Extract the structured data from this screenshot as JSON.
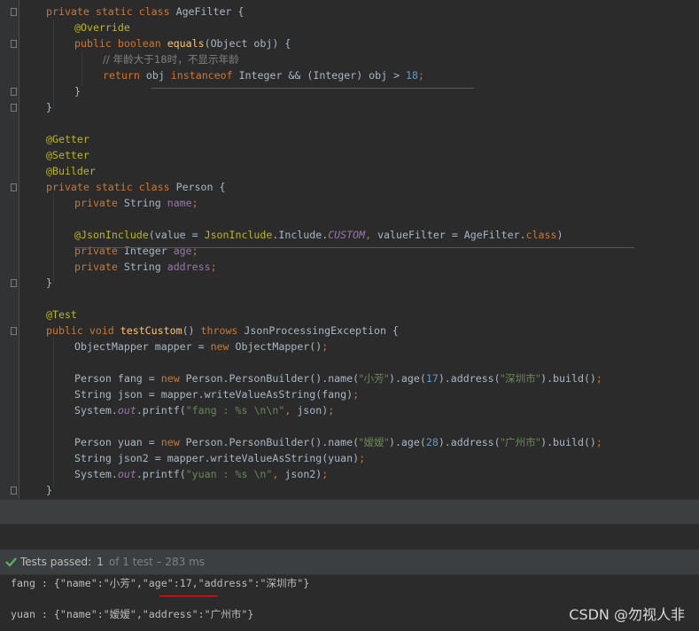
{
  "code": {
    "lines": [
      [
        [
          "kw",
          "private static class "
        ],
        [
          "p",
          "AgeFilter {"
        ]
      ],
      [
        [
          "ann",
          "@Override"
        ]
      ],
      [
        [
          "kw",
          "public boolean "
        ],
        [
          "fn",
          "equals"
        ],
        [
          "p",
          "(Object obj) {"
        ]
      ],
      [
        [
          "cmt",
          "// 年龄大于18时，不显示年龄"
        ]
      ],
      [
        [
          "kw",
          "return "
        ],
        [
          "p",
          "obj "
        ],
        [
          "kw",
          "instanceof "
        ],
        [
          "p",
          "Integer && (Integer) obj > "
        ],
        [
          "num",
          "18"
        ],
        [
          "kw",
          ";"
        ]
      ],
      [
        [
          "p",
          "}"
        ]
      ],
      [
        [
          "p",
          "}"
        ]
      ],
      [],
      [
        [
          "ann",
          "@Getter"
        ]
      ],
      [
        [
          "ann",
          "@Setter"
        ]
      ],
      [
        [
          "ann",
          "@Builder"
        ]
      ],
      [
        [
          "kw",
          "private static class "
        ],
        [
          "p",
          "Person {"
        ]
      ],
      [
        [
          "kw",
          "private "
        ],
        [
          "p",
          "String "
        ],
        [
          "fld",
          "name"
        ],
        [
          "kw",
          ";"
        ]
      ],
      [],
      [
        [
          "ann",
          "@JsonInclude"
        ],
        [
          "p",
          "(value = "
        ],
        [
          "ann",
          "JsonInclude"
        ],
        [
          "p",
          "."
        ],
        [
          "p",
          "Include."
        ],
        [
          "fld-i",
          "CUSTOM"
        ],
        [
          "kw",
          ", "
        ],
        [
          "p",
          "valueFilter = AgeFilter."
        ],
        [
          "kw",
          "class"
        ],
        [
          "p",
          ")"
        ]
      ],
      [
        [
          "kw",
          "private "
        ],
        [
          "p",
          "Integer "
        ],
        [
          "fld",
          "age"
        ],
        [
          "kw",
          ";"
        ]
      ],
      [
        [
          "kw",
          "private "
        ],
        [
          "p",
          "String "
        ],
        [
          "fld",
          "address"
        ],
        [
          "kw",
          ";"
        ]
      ],
      [
        [
          "p",
          "}"
        ]
      ],
      [],
      [
        [
          "ann",
          "@Test"
        ]
      ],
      [
        [
          "kw",
          "public void "
        ],
        [
          "fn",
          "testCustom"
        ],
        [
          "p",
          "() "
        ],
        [
          "kw",
          "throws "
        ],
        [
          "p",
          "JsonProcessingException {"
        ]
      ],
      [
        [
          "p",
          "ObjectMapper mapper = "
        ],
        [
          "kw",
          "new "
        ],
        [
          "p",
          "ObjectMapper()"
        ],
        [
          "kw",
          ";"
        ]
      ],
      [],
      [
        [
          "p",
          "Person fang = "
        ],
        [
          "kw",
          "new "
        ],
        [
          "p",
          "Person.PersonBuilder().name("
        ],
        [
          "str",
          "\"小芳\""
        ],
        [
          "p",
          ").age("
        ],
        [
          "num",
          "17"
        ],
        [
          "p",
          ").address("
        ],
        [
          "str",
          "\"深圳市\""
        ],
        [
          "p",
          ").build()"
        ],
        [
          "kw",
          ";"
        ]
      ],
      [
        [
          "p",
          "String json = mapper.writeValueAsString(fang)"
        ],
        [
          "kw",
          ";"
        ]
      ],
      [
        [
          "p",
          "System."
        ],
        [
          "fld-i",
          "out"
        ],
        [
          "p",
          ".printf("
        ],
        [
          "str",
          "\"fang : %s \\n\\n\""
        ],
        [
          "kw",
          ", "
        ],
        [
          "p",
          "json)"
        ],
        [
          "kw",
          ";"
        ]
      ],
      [],
      [
        [
          "p",
          "Person yuan = "
        ],
        [
          "kw",
          "new "
        ],
        [
          "p",
          "Person.PersonBuilder().name("
        ],
        [
          "str",
          "\"嫒嫒\""
        ],
        [
          "p",
          ").age("
        ],
        [
          "num",
          "28"
        ],
        [
          "p",
          ").address("
        ],
        [
          "str",
          "\"广州市\""
        ],
        [
          "p",
          ").build()"
        ],
        [
          "kw",
          ";"
        ]
      ],
      [
        [
          "p",
          "String json2 = mapper.writeValueAsString(yuan)"
        ],
        [
          "kw",
          ";"
        ]
      ],
      [
        [
          "p",
          "System."
        ],
        [
          "fld-i",
          "out"
        ],
        [
          "p",
          ".printf("
        ],
        [
          "str",
          "\"yuan : %s \\n\""
        ],
        [
          "kw",
          ", "
        ],
        [
          "p",
          "json2)"
        ],
        [
          "kw",
          ";"
        ]
      ],
      [
        [
          "p",
          "}"
        ]
      ]
    ]
  },
  "test_status": {
    "passed_label": "Tests passed:",
    "count": "1",
    "detail": "of 1 test – 283 ms"
  },
  "output": {
    "line1": "fang : {\"name\":\"小芳\",\"age\":17,\"address\":\"深圳市\"}",
    "line2": "yuan : {\"name\":\"嫒嫒\",\"address\":\"广州市\"}"
  },
  "watermark": "CSDN @勿视人非",
  "colors": {
    "background": "#2b2b2b",
    "keyword": "#cc7832",
    "annotation": "#bbb529",
    "string": "#6a8759",
    "number": "#6897bb",
    "field": "#9876aa",
    "method": "#ffc66d",
    "underline": "#e02020",
    "pass": "#5eb35e"
  }
}
